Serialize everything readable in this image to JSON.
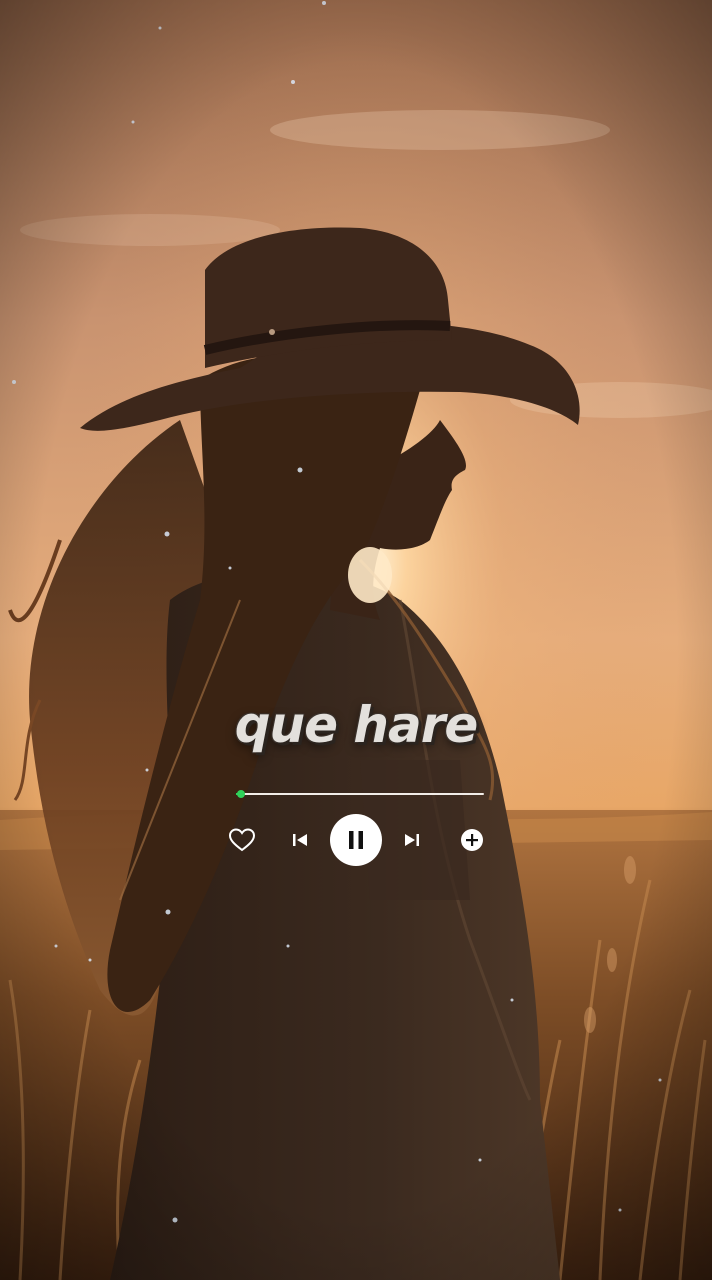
{
  "player": {
    "song_title": "que hare",
    "progress": 0.02,
    "is_playing": true,
    "colors": {
      "accent": "#2fd15a",
      "icon": "#ffffff",
      "title": "#e3e0dc"
    },
    "icons": {
      "like": "heart-outline-icon",
      "previous": "skip-previous-icon",
      "play_pause": "pause-icon",
      "next": "skip-next-icon",
      "add": "plus-circle-icon"
    }
  }
}
